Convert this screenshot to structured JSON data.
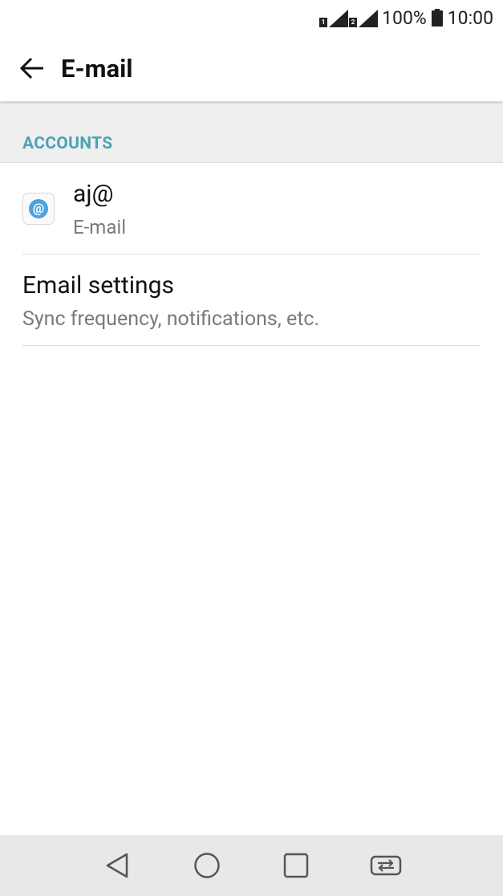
{
  "status_bar": {
    "sim1_label": "1",
    "sim2_label": "2",
    "battery_percent": "100%",
    "time": "10:00"
  },
  "app_bar": {
    "title": "E-mail",
    "back_icon": "arrow-left-icon"
  },
  "section": {
    "title": "ACCOUNTS"
  },
  "account": {
    "name": "aj@",
    "type": "E-mail",
    "icon": "at-sign-icon"
  },
  "settings": {
    "title": "Email settings",
    "subtitle": "Sync frequency, notifications, etc."
  },
  "nav_bar": {
    "icons": [
      "back-triangle-icon",
      "home-circle-icon",
      "recents-square-icon",
      "dual-window-icon"
    ]
  },
  "colors": {
    "accent": "#4aa3b5",
    "section_bg": "#efefef",
    "nav_bg": "#e8e8e8"
  }
}
